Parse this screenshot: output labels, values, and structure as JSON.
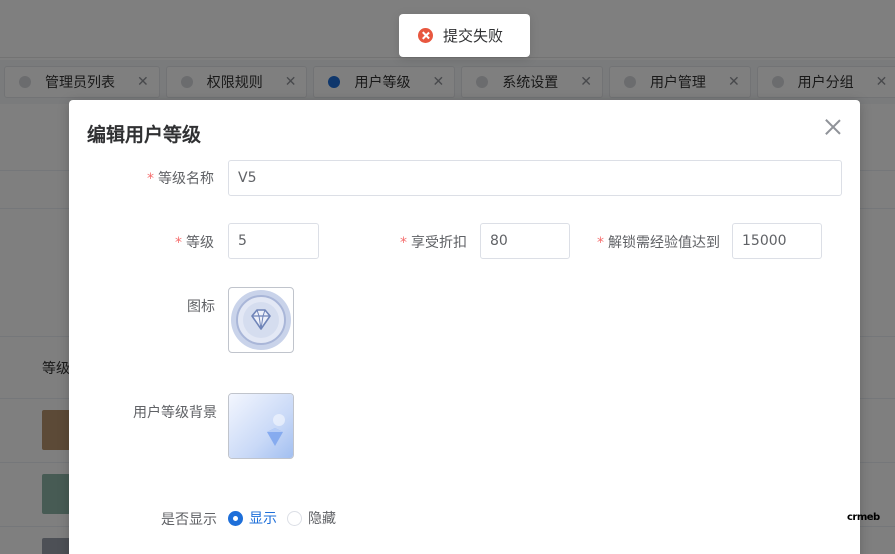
{
  "toast": {
    "message": "提交失败",
    "icon": "error-circle-icon",
    "color": "#e8573f"
  },
  "tabs": [
    {
      "label": "管理员列表",
      "active": false
    },
    {
      "label": "权限规则",
      "active": false
    },
    {
      "label": "用户等级",
      "active": true
    },
    {
      "label": "系统设置",
      "active": false
    },
    {
      "label": "用户管理",
      "active": false
    },
    {
      "label": "用户分组",
      "active": false
    }
  ],
  "background_page": {
    "column_label": "等级"
  },
  "dialog": {
    "title": "编辑用户等级",
    "required_mark": "*",
    "fields": {
      "level_name": {
        "label": "等级名称",
        "value": "V5"
      },
      "level": {
        "label": "等级",
        "value": "5"
      },
      "discount": {
        "label": "享受折扣",
        "value": "80"
      },
      "unlock_exp": {
        "label": "解锁需经验值达到",
        "value": "15000"
      },
      "icon": {
        "label": "图标",
        "image": "diamond-badge-icon"
      },
      "background": {
        "label": "用户等级背景",
        "image": "level-background-image"
      },
      "visible": {
        "label": "是否显示",
        "options": [
          "显示",
          "隐藏"
        ],
        "selected": "显示"
      }
    }
  },
  "corner_mark": "crmeb",
  "colors": {
    "primary": "#1e6fd9",
    "required": "#f56c6c",
    "overlay": "rgba(0,0,0,0.5)"
  }
}
